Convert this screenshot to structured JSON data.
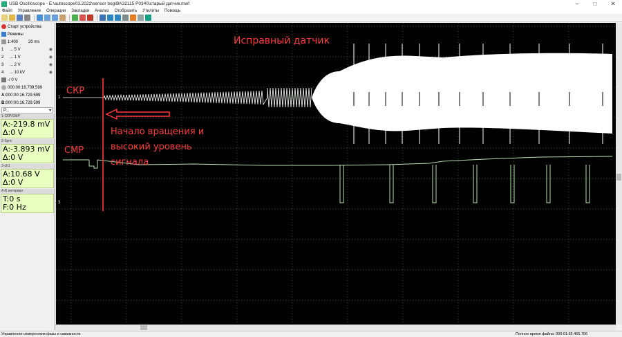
{
  "window": {
    "title": "USB Oscilloscope - E:\\autoscope03.2022\\sensor bog\\ВАЗ2115 P0340\\старый датчик.mwf"
  },
  "menu": [
    "Файл",
    "Управление",
    "Операции",
    "Закладки",
    "Анализ",
    "Отобразить",
    "Утилиты",
    "Помощь"
  ],
  "panel": {
    "start_label": "Старт устройства",
    "modes_label": "Режимы",
    "timebase": {
      "left": "1:400",
      "right": "20 ms"
    },
    "channels": [
      {
        "num": "1",
        "value": "... 5 V"
      },
      {
        "num": "2",
        "value": "... 1 V"
      },
      {
        "num": "3",
        "value": "... 2 V"
      },
      {
        "num": "4",
        "value": "... 10 kV"
      }
    ],
    "trigger_value": "-/ 0 V",
    "times": [
      {
        "prefix": "",
        "value": "000:00:16.709.599"
      },
      {
        "prefix": "A:",
        "value": "000:00:16.729.599"
      },
      {
        "prefix": "B:",
        "value": "000:00:16.729.599"
      }
    ],
    "dropdown_label": "P...",
    "sections": [
      {
        "header": "1-СКР/CMP",
        "lines": [
          "A:-219.8 mV",
          "Δ:0 V"
        ]
      },
      {
        "header": "2-Sync",
        "lines": [
          "A:-3.893 mV",
          "Δ:0 V"
        ]
      },
      {
        "header": "3-ch1",
        "lines": [
          "A:10.68 V",
          "Δ:0 V"
        ]
      },
      {
        "header": "A-B интервал",
        "lines": [
          "T:0 s",
          "F:0 Hz"
        ]
      }
    ]
  },
  "scope": {
    "title": "Исправный датчик",
    "label_ckp": "СКР",
    "label_cmp": "СМР",
    "note_lines": [
      "Начало вращения и",
      "высокий уровень",
      "сигнала"
    ],
    "marker_1": "1",
    "marker_3": "3"
  },
  "status": {
    "left": "Управление измерением фазы и скважности",
    "right": "Полное время файла: 000:01:55.465.706"
  },
  "colors": {
    "scope_bg": "#000000",
    "grid": "#2c5a2c",
    "ckp_trace": "#ffffff",
    "cmp_trace": "#b8e0b0",
    "annotation": "#ff3b3b",
    "measure_bg": "#e8ffc0"
  }
}
